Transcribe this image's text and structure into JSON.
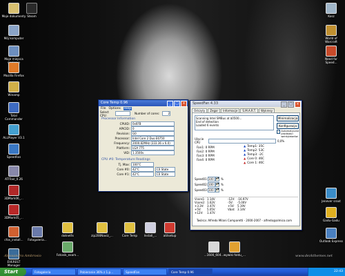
{
  "desktop": {
    "icons_left": [
      {
        "label": "Moje dokumenty"
      },
      {
        "label": "Mój komputer"
      },
      {
        "label": "Moje miejsca sieciowe"
      },
      {
        "label": "Mozilla Firefox"
      },
      {
        "label": "Winamp"
      },
      {
        "label": "Total Commander"
      },
      {
        "label": "ALLPlayer V3.1"
      },
      {
        "label": "SpeedFan"
      },
      {
        "label": "ATITool_0.26"
      },
      {
        "label": "3DMark06_..."
      },
      {
        "label": "3DMark05_..."
      },
      {
        "label": "cfos_install..."
      },
      {
        "label": "EVEREST Manager"
      }
    ],
    "icons_top": [
      {
        "label": "Steam"
      }
    ],
    "icons_right": [
      {
        "label": "Kosz"
      },
      {
        "label": "World of Warcraft"
      },
      {
        "label": "Need for Speed..."
      },
      {
        "label": "Jenever sroot"
      },
      {
        "label": "Gadu-Gadu"
      },
      {
        "label": "Outlook Express"
      }
    ],
    "icons_bottom": [
      {
        "label": "Fotogaleria..."
      },
      {
        "label": "dotnetfx"
      },
      {
        "label": "Fotosik_exam..."
      },
      {
        "label": "zip200Naviz_..."
      },
      {
        "label": "Core Temp"
      },
      {
        "label": "Install_..."
      },
      {
        "label": "atitsetup"
      },
      {
        "label": "...1600_604..."
      },
      {
        "label": "wywiki foldu_..."
      }
    ],
    "watermark_left": "Alessandra Ambrosio",
    "watermark_right": "www.dezkthemes.net"
  },
  "coretemp": {
    "title": "Core Temp 0.96",
    "menu": [
      "File",
      "Options",
      "Help"
    ],
    "select_cpu_label": "Select CPU:",
    "number_cores_label": "Number of cores:",
    "number_cores_value": "2",
    "proc_info_title": "Processor Information",
    "rows": [
      {
        "k": "CPUID:",
        "v": "0x6FB"
      },
      {
        "k": "APICID:",
        "v": "0"
      },
      {
        "k": "Revision:",
        "v": "G0"
      },
      {
        "k": "Processor:",
        "v": "Intel Core 2 Duo E6750 (Conroe)"
      },
      {
        "k": "Frequency:",
        "v": "2000.82MHz (333.36 x 6.0)"
      },
      {
        "k": "Platform:",
        "v": "LGA 775"
      },
      {
        "k": "VID:",
        "v": "1.3500v"
      }
    ],
    "temp_title": "CPU #0: Temperature Readings",
    "tjmax": {
      "k": "Tj. Max:",
      "v": "100°C"
    },
    "cores": [
      {
        "k": "Core #0:",
        "v": "42°C",
        "state": "C0 State"
      },
      {
        "k": "Core #1:",
        "v": "42°C",
        "state": "C0 State"
      }
    ]
  },
  "speedfan": {
    "title": "SpeedFan 4.33",
    "tabs": [
      "Odczyty",
      "Zegar",
      "Informacje",
      "S.M.A.R.T.",
      "Wykresy"
    ],
    "log": [
      "Scanning Intel SMBus at $0500...",
      "End of detection",
      "Loaded 6 events"
    ],
    "btn_minimize": "Minimalizacja",
    "btn_config": "Konfiguracja",
    "auto_label": "Automatyczne prędkości wentylatorów",
    "usage_label": "Użycie CPU",
    "usage_value": "0,0%",
    "fans": [
      "Fan1: 0 RPM",
      "Fan2: 0 RPM",
      "Fan3: 0 RPM",
      "Fan4: 0 RPM"
    ],
    "temps": [
      "Temp1: 35C",
      "Temp2: 53C",
      "Temp3: -2C",
      "Core 0: 46C",
      "Core 1: 46C"
    ],
    "speeds": [
      {
        "label": "Speed01:",
        "value": "100",
        "unit": "%"
      },
      {
        "label": "Speed02:",
        "value": "100",
        "unit": "%"
      },
      {
        "label": "Speed03:",
        "value": "100",
        "unit": "%"
      }
    ],
    "volts": [
      [
        "Vcore1:",
        "1.14V",
        "-12V:",
        "-16.97V"
      ],
      [
        "Vcore2:",
        "1.62V",
        "-5V:",
        "-5.00V"
      ],
      [
        "+3.3V:",
        "3.47V",
        "+5V:",
        "5.19V"
      ],
      [
        "+5V:",
        "5.05V",
        "Vbat:",
        "3.14V"
      ],
      [
        "+12V:",
        "1.47V",
        "",
        ""
      ]
    ],
    "footer": "Twórca: Alfredo Milani Comparetti - 2000-2007 - alfredo@almico.com"
  },
  "taskbar": {
    "start": "Start",
    "tasks": [
      "Fotogaleria",
      "Pobieranie 36% z 1.p...",
      "SpeedFan",
      "Core Temp 0.96"
    ],
    "clock": "22:43"
  }
}
